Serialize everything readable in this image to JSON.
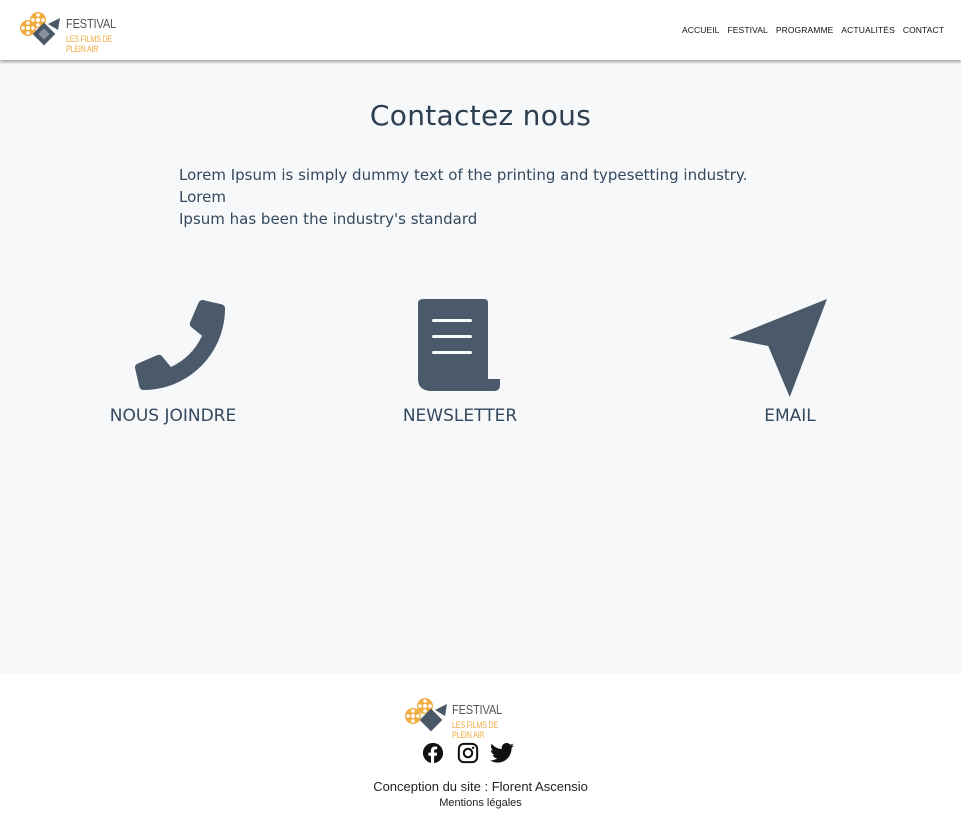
{
  "brand": {
    "name": "FESTIVAL",
    "tagline": "LES FILMS DE PLEIN AIR",
    "colors": {
      "accent": "#f0ad42",
      "dark": "#4a5867"
    }
  },
  "nav": {
    "items": [
      "ACCUEIL",
      "FESTIVAL",
      "PROGRAMME",
      "ACTUALITÉS",
      "CONTACT"
    ]
  },
  "main": {
    "title": "Contactez nous",
    "intro_line1": "Lorem Ipsum is simply dummy text of the printing and typesetting industry. Lorem",
    "intro_line2": "Ipsum has been the industry's standard",
    "cards": [
      {
        "label": "NOUS JOINDRE",
        "icon": "phone-icon"
      },
      {
        "label": "NEWSLETTER",
        "icon": "scroll-icon"
      },
      {
        "label": "EMAIL",
        "icon": "paper-plane-icon"
      }
    ],
    "icon_color": "#4a5a6a"
  },
  "footer": {
    "socials": [
      "facebook-icon",
      "instagram-icon",
      "twitter-icon"
    ],
    "credit": "Conception du site : Florent Ascensio",
    "legal": "Mentions légales"
  }
}
